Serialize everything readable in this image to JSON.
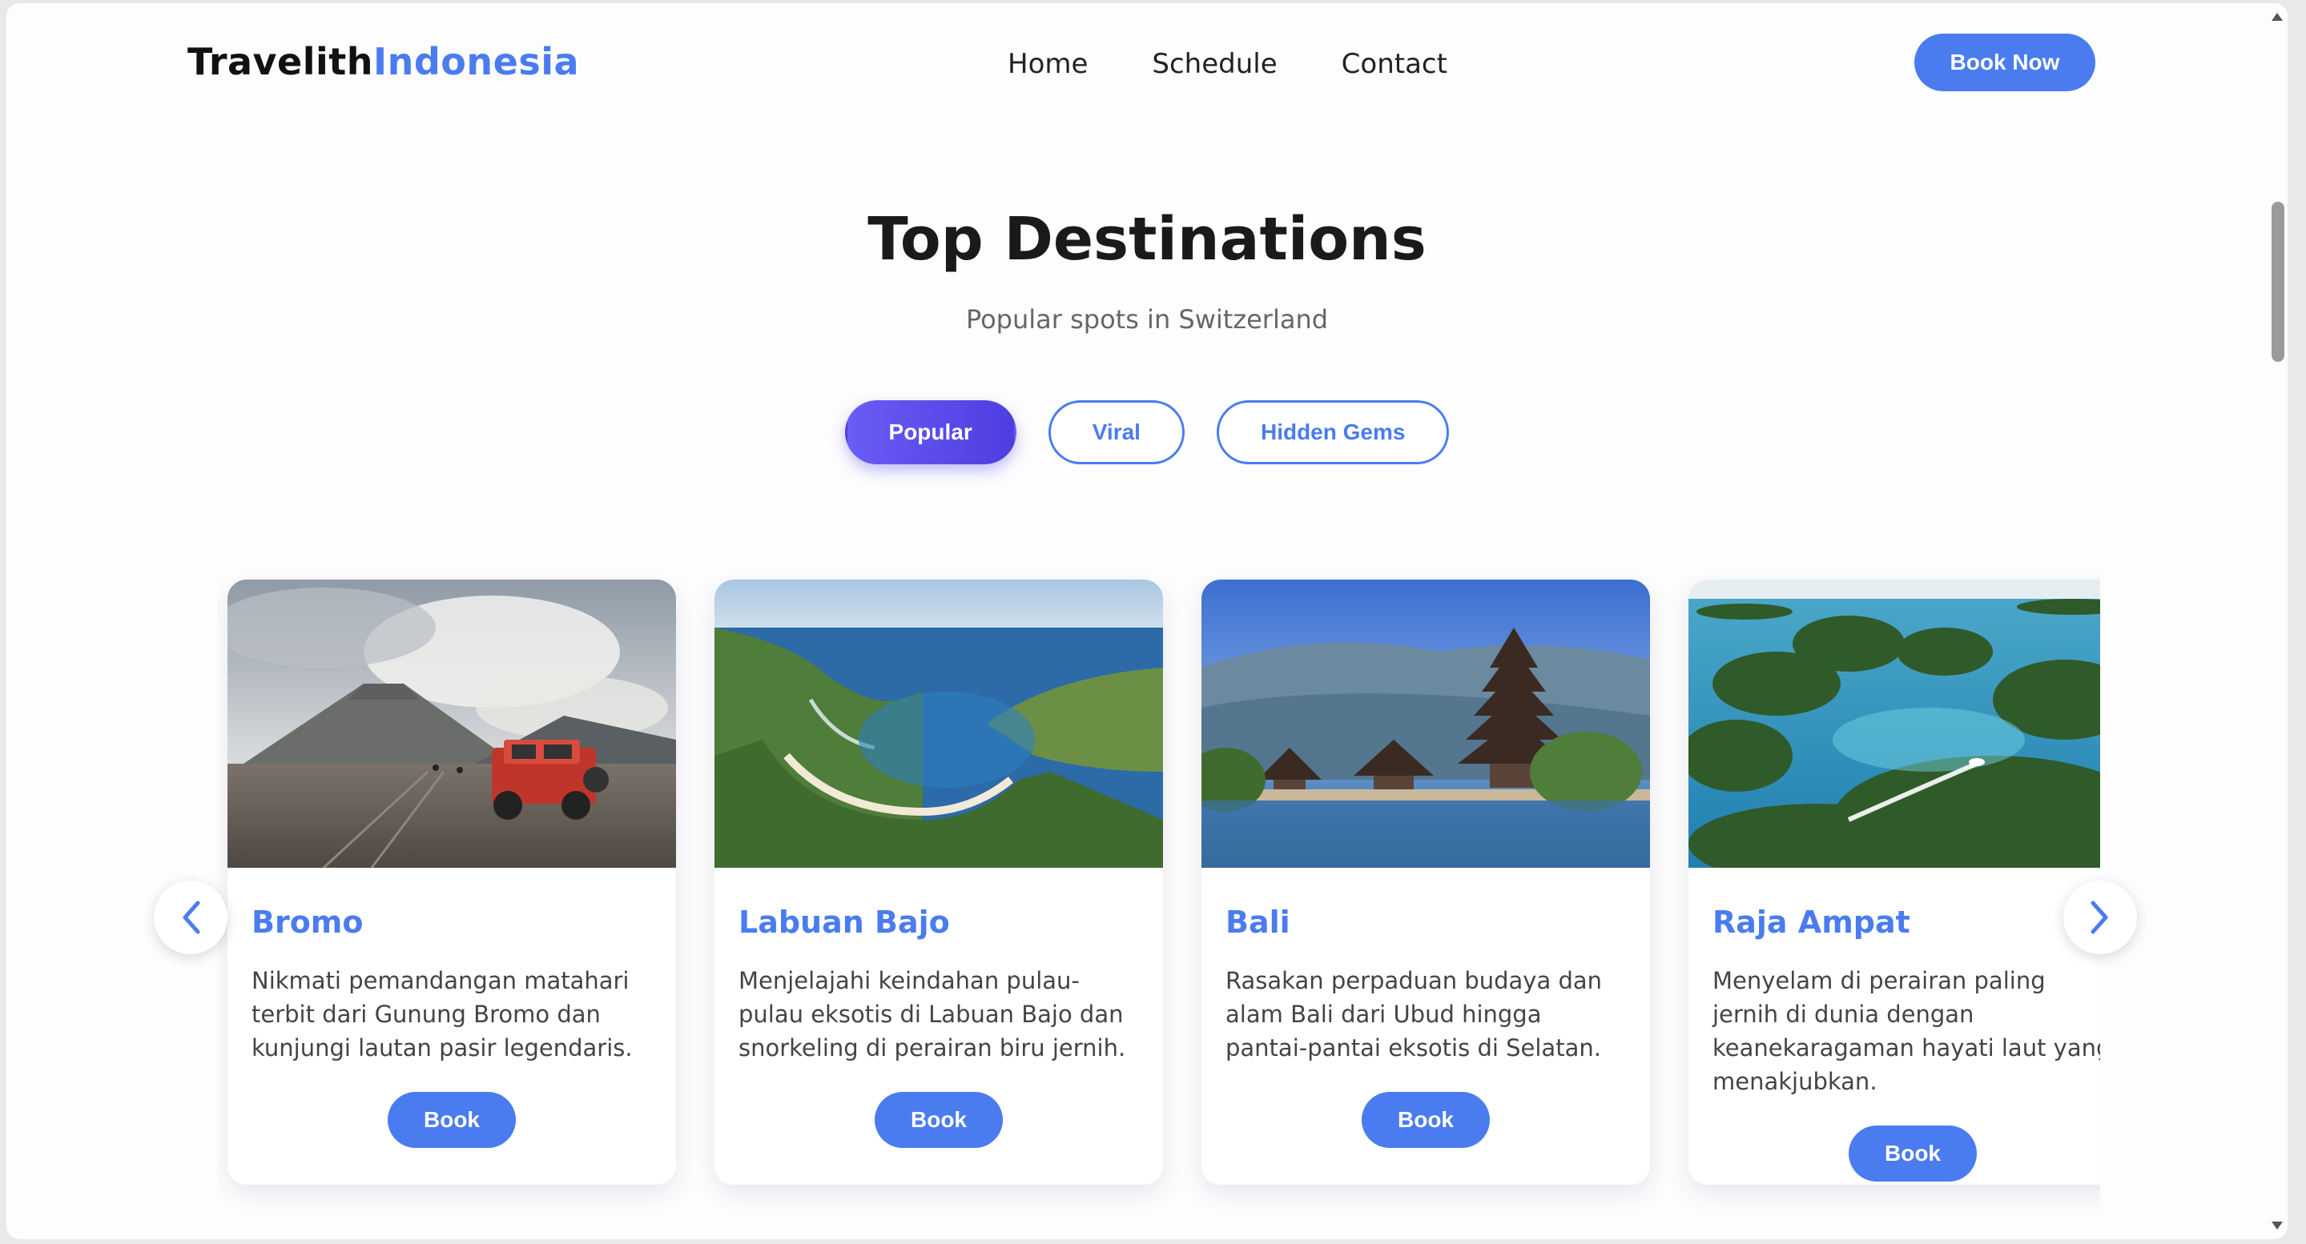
{
  "nav": {
    "logo_primary": "Travelith",
    "logo_accent": "Indonesia",
    "links": [
      "Home",
      "Schedule",
      "Contact"
    ],
    "cta": "Book Now"
  },
  "hero": {
    "title": "Top Destinations",
    "subtitle": "Popular spots in Switzerland"
  },
  "filters": [
    {
      "label": "Popular",
      "active": true
    },
    {
      "label": "Viral",
      "active": false
    },
    {
      "label": "Hidden Gems",
      "active": false
    }
  ],
  "cards": [
    {
      "title": "Bromo",
      "desc": "Nikmati pemandangan matahari terbit dari Gunung Bromo dan kunjungi lautan pasir legendaris.",
      "button": "Book"
    },
    {
      "title": "Labuan Bajo",
      "desc": "Menjelajahi keindahan pulau-pulau eksotis di Labuan Bajo dan snorkeling di perairan biru jernih.",
      "button": "Book"
    },
    {
      "title": "Bali",
      "desc": "Rasakan perpaduan budaya dan alam Bali dari Ubud hingga pantai-pantai eksotis di Selatan.",
      "button": "Book"
    },
    {
      "title": "Raja Ampat",
      "desc": "Menyelam di perairan paling jernih di dunia dengan keanekaragaman hayati laut yang menakjubkan.",
      "button": "Book"
    }
  ],
  "carousel": {
    "prev_icon": "chevron-left-icon",
    "next_icon": "chevron-right-icon"
  },
  "colors": {
    "accent": "#4a7cf0",
    "active_pill": "#5b4cf0"
  }
}
